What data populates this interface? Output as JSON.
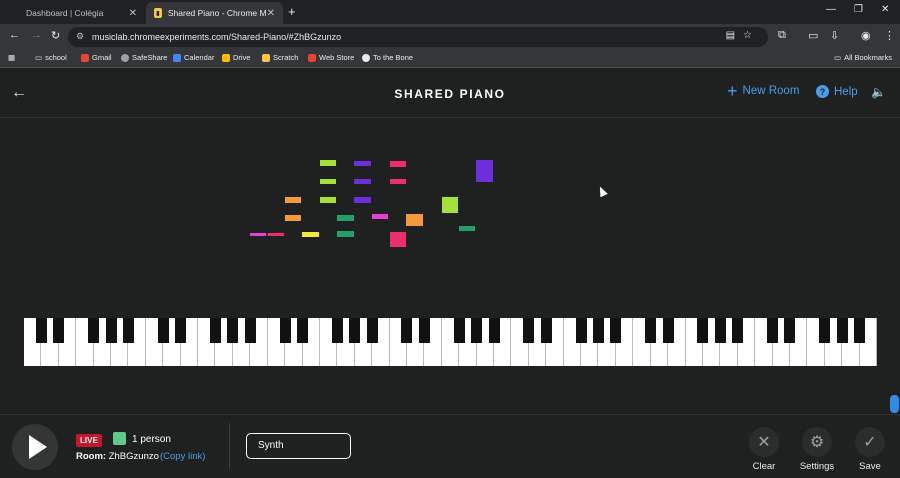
{
  "browser": {
    "tabs": [
      {
        "title": "Dashboard | Colégia",
        "active": false
      },
      {
        "title": "Shared Piano - Chrome Music La",
        "active": true
      }
    ],
    "url": "musiclab.chromeexperiments.com/Shared-Piano/#ZhBGzunzo",
    "bookmarks": [
      "school",
      "Gmail",
      "SafeShare",
      "Calendar",
      "Drive",
      "Scratch",
      "Web Store",
      "To the Bone"
    ],
    "all_bookmarks_label": "All Bookmarks"
  },
  "app": {
    "title": "SHARED PIANO",
    "new_room_label": "New Room",
    "help_label": "Help"
  },
  "notes": [
    {
      "color": "#a6e13b"
    },
    {
      "color": "#6c2fdb"
    },
    {
      "color": "#ee2d6b"
    },
    {
      "color": "#6c2fdb"
    },
    {
      "color": "#a6e13b"
    },
    {
      "color": "#6c2fdb"
    },
    {
      "color": "#ee2d6b"
    },
    {
      "color": "#a6e13b"
    },
    {
      "color": "#6c2fdb"
    },
    {
      "color": "#f59a3b"
    },
    {
      "color": "#a6e13b"
    },
    {
      "color": "#f59a3b"
    },
    {
      "color": "#21a06a"
    },
    {
      "color": "#e63fd3"
    },
    {
      "color": "#f59a3b"
    },
    {
      "color": "#21a06a"
    },
    {
      "color": "#e63fd3"
    },
    {
      "color": "#ee2d6b"
    },
    {
      "color": "#f5e83b"
    },
    {
      "color": "#21a06a"
    },
    {
      "color": "#ee2d6b"
    }
  ],
  "colors": {
    "accent": "#4b9de9",
    "live": "#c8152e",
    "background": "#1e2120"
  },
  "bottom": {
    "live_label": "LIVE",
    "people": "1 person",
    "room_label": "Room:",
    "room_id": "ZhBGzunzo",
    "copy_link": "(Copy link)",
    "instrument": "Synth",
    "actions": [
      {
        "label": "Clear",
        "icon": "close-icon"
      },
      {
        "label": "Settings",
        "icon": "gear-icon"
      },
      {
        "label": "Save",
        "icon": "check-icon"
      }
    ]
  }
}
